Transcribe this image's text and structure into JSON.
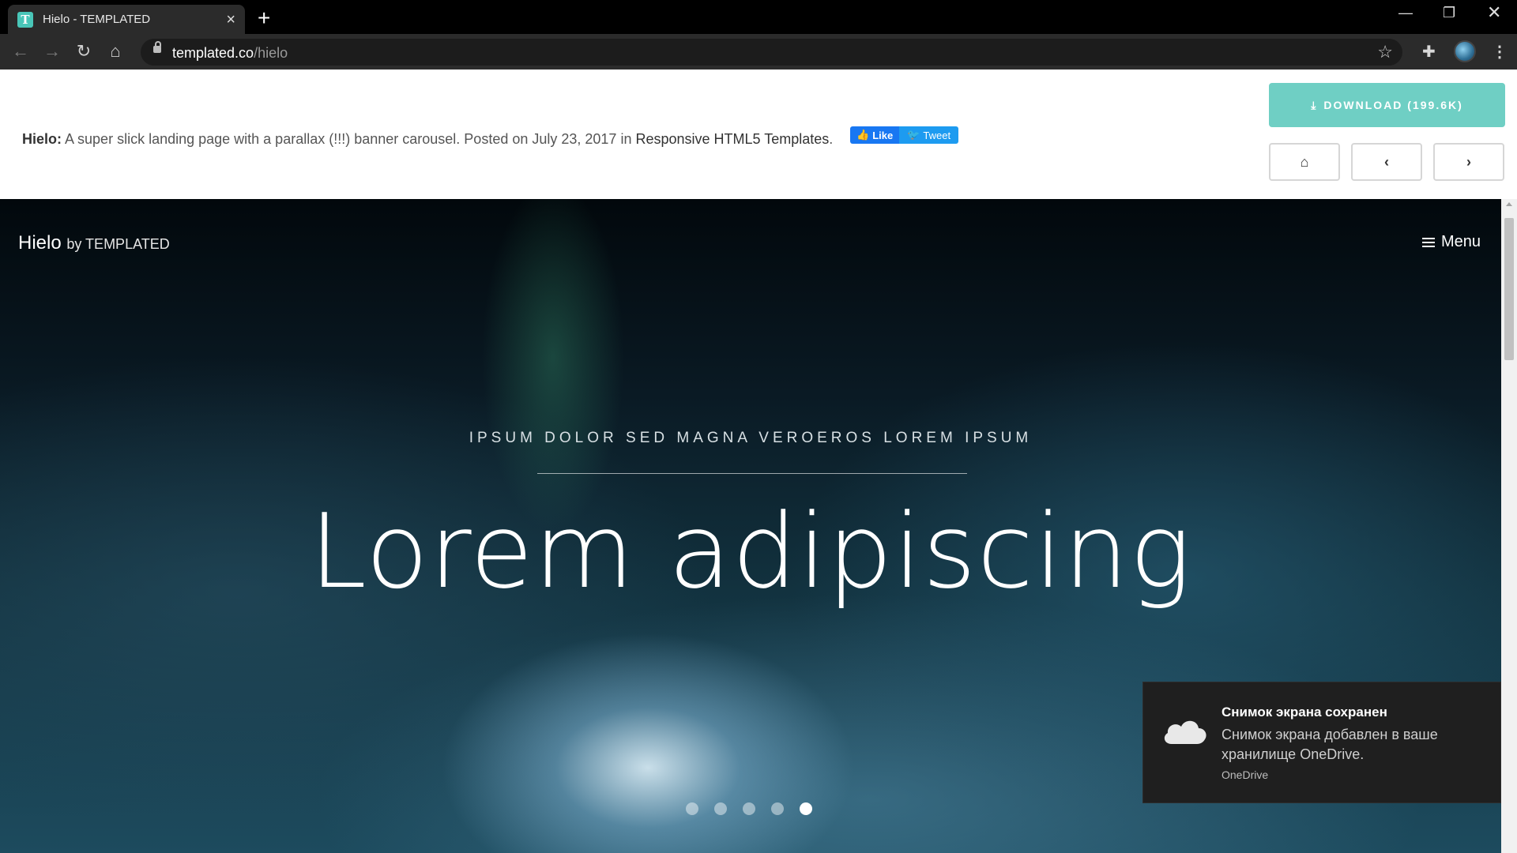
{
  "browser": {
    "tab_title": "Hielo - TEMPLATED",
    "favicon_letter": "T",
    "url_host": "templated.co",
    "url_path": "/hielo"
  },
  "templated_bar": {
    "name": "Hielo:",
    "description": " A super slick landing page with a parallax (!!!) banner carousel. Posted on July 23, 2017 in ",
    "category_link": "Responsive HTML5 Templates",
    "period": ".",
    "like_label": "Like",
    "tweet_label": "Tweet",
    "download_label": "DOWNLOAD (199.6K)"
  },
  "hero": {
    "brand": "Hielo",
    "brand_by": "by TEMPLATED",
    "menu_label": "Menu",
    "subtitle": "IPSUM DOLOR SED MAGNA VEROEROS LOREM IPSUM",
    "headline": "Lorem adipiscing",
    "slide_count": 5,
    "active_slide": 5
  },
  "toast": {
    "title": "Снимок экрана сохранен",
    "body": "Снимок экрана добавлен в ваше хранилище OneDrive.",
    "app": "OneDrive"
  },
  "colors": {
    "accent_teal": "#6fcfc4",
    "facebook": "#1877f2",
    "twitter": "#1d9bf0"
  }
}
